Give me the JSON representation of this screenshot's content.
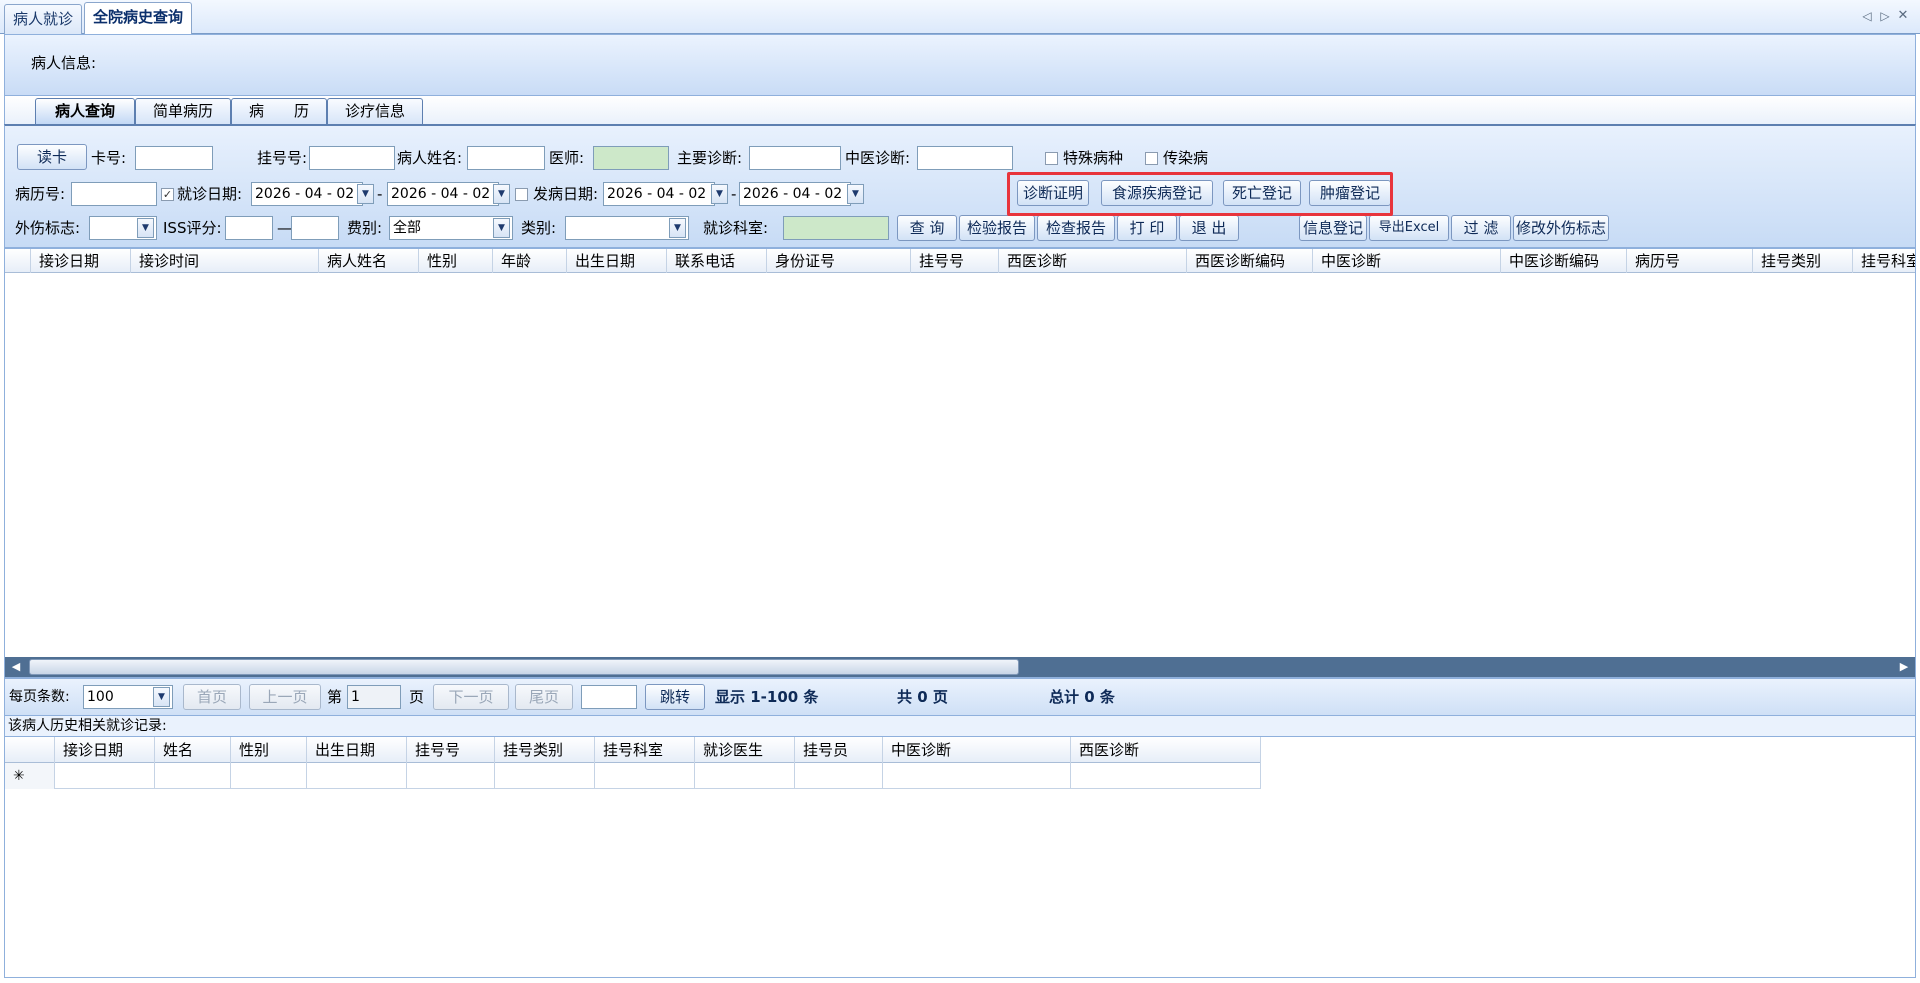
{
  "doc_tabs": [
    "病人就诊",
    "全院病史查询"
  ],
  "nav": {
    "prev": "◁",
    "next": "▷",
    "close": "✕"
  },
  "patient_info_label": "病人信息:",
  "inner_tabs": [
    "病人查询",
    "简单病历",
    "病　　历",
    "诊疗信息"
  ],
  "filters": {
    "read_card": "读卡",
    "card_no": "卡号:",
    "reg_no": "挂号号:",
    "patient_name": "病人姓名:",
    "doctor": "医师:",
    "main_diag": "主要诊断:",
    "tcm_diag": "中医诊断:",
    "special_disease": "特殊病种",
    "infectious": "传染病",
    "record_no": "病历号:",
    "visit_date": "就诊日期:",
    "visit_date_from": "2026 - 04 - 02",
    "visit_date_to": "2026 - 04 - 02",
    "onset_date": "发病日期:",
    "onset_date_from": "2026 - 04 - 02",
    "onset_date_to": "2026 - 04 - 02",
    "dash": "-",
    "trauma_flag": "外伤标志:",
    "iss_score": "ISS评分:",
    "iss_dash": "—",
    "fee_type": "费别:",
    "fee_value": "全部",
    "category": "类别:",
    "dept": "就诊科室:",
    "check_mark": "✓"
  },
  "buttons": {
    "diag_cert": "诊断证明",
    "food_disease": "食源疾病登记",
    "death_reg": "死亡登记",
    "tumor_reg": "肿瘤登记",
    "query": "查 询",
    "lab_report": "检验报告",
    "exam_report": "检查报告",
    "print": "打 印",
    "exit": "退 出",
    "info_reg": "信息登记",
    "export_excel": "导出Excel",
    "filter": "过 滤",
    "edit_trauma": "修改外伤标志"
  },
  "grid1": {
    "columns": [
      "接诊日期",
      "接诊时间",
      "病人姓名",
      "性别",
      "年龄",
      "出生日期",
      "联系电话",
      "身份证号",
      "挂号号",
      "西医诊断",
      "西医诊断编码",
      "中医诊断",
      "中医诊断编码",
      "病历号",
      "挂号类别",
      "挂号科室"
    ]
  },
  "pager": {
    "per_page_label": "每页条数:",
    "per_page_value": "100",
    "first": "首页",
    "prev": "上一页",
    "page_prefix": "第",
    "page_value": "1",
    "page_suffix": "页",
    "next": "下一页",
    "last": "尾页",
    "jump": "跳转",
    "showing": "显示 1-100 条",
    "total_pages": "共 0 页",
    "total_records": "总计 0 条"
  },
  "history_label": "该病人历史相关就诊记录:",
  "grid2": {
    "columns": [
      "接诊日期",
      "姓名",
      "性别",
      "出生日期",
      "挂号号",
      "挂号类别",
      "挂号科室",
      "就诊医生",
      "挂号员",
      "中医诊断",
      "西医诊断"
    ],
    "new_row_marker": "✳"
  },
  "colors": {
    "highlight": "#e8343c",
    "header_blue": "#c9dcf6",
    "scroll": "#4f6f93",
    "green_field": "#cde8c9"
  }
}
